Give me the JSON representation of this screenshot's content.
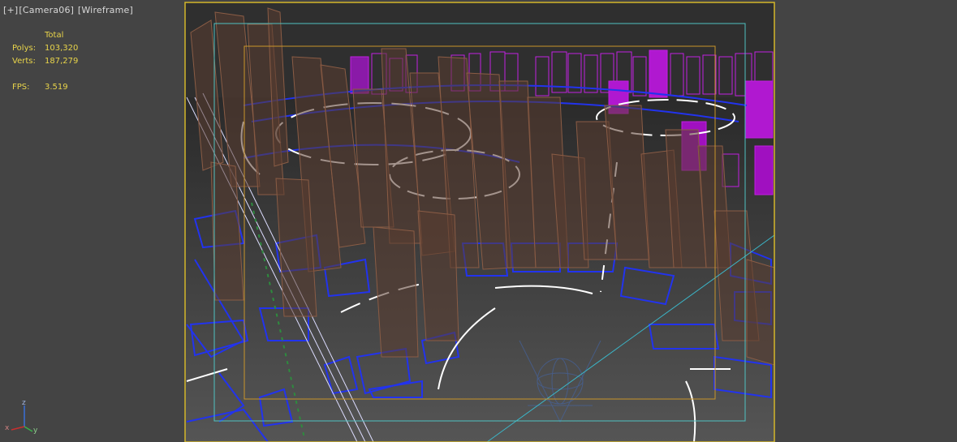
{
  "viewport": {
    "plus_label": "[+]",
    "camera_label": "[Camera06]",
    "mode_label": "[Wireframe]"
  },
  "stats": {
    "total_header": "Total",
    "polys_label": "Polys:",
    "polys_value": "103,320",
    "verts_label": "Verts:",
    "verts_value": "187,279",
    "fps_label": "FPS:",
    "fps_value": "3.519"
  },
  "axis": {
    "x_label": "x",
    "y_label": "y",
    "z_label": "z"
  },
  "colors": {
    "background": "#444444",
    "viewport_bg": "#2f2f2f",
    "safe_frame_outer": "#d4b62a",
    "safe_frame_inner": "#4fc2c2",
    "action_safe": "#c9952a",
    "building_brown": "#8a5c45",
    "building_magenta": "#c020e0",
    "road_blue": "#2233ee",
    "road_white": "#ffffff",
    "stats_text": "#e8d44a"
  }
}
